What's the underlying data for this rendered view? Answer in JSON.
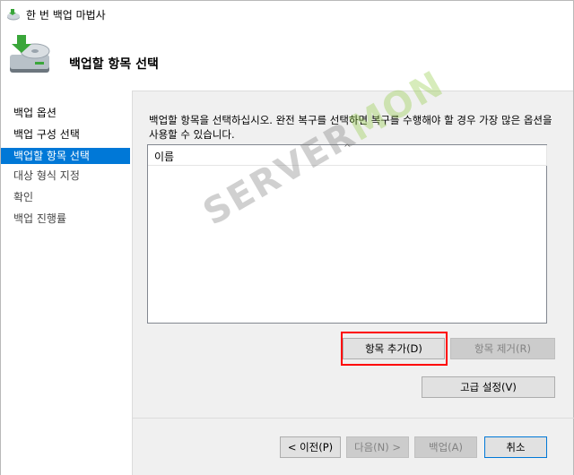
{
  "window": {
    "title": "한 번 백업 마법사",
    "heading": "백업할 항목 선택"
  },
  "nav": {
    "items": [
      {
        "label": "백업 옵션",
        "state": "normal"
      },
      {
        "label": "백업 구성 선택",
        "state": "normal"
      },
      {
        "label": "백업할 항목 선택",
        "state": "active"
      },
      {
        "label": "대상 형식 지정",
        "state": "dim"
      },
      {
        "label": "확인",
        "state": "dim"
      },
      {
        "label": "백업 진행률",
        "state": "dim"
      }
    ]
  },
  "main": {
    "description": "백업할 항목을 선택하십시오. 완전 복구를 선택하면 복구를 수행해야 할 경우 가장 많은 옵션을 사용할 수 있습니다.",
    "list": {
      "column_name": "이름",
      "sort_indicator": "^",
      "rows": []
    },
    "add_item_label": "항목 추가(D)",
    "remove_item_label": "항목 제거(R)",
    "advanced_settings_label": "고급 설정(V)"
  },
  "footer": {
    "previous_label": "< 이전(P)",
    "next_label": "다음(N) >",
    "backup_label": "백업(A)",
    "cancel_label": "취소"
  },
  "watermark": {
    "part1": "SERVER",
    "part2": "MON"
  },
  "colors": {
    "accent": "#0078d7",
    "highlight": "#ff0000",
    "watermark_green": "#8cc83c"
  }
}
